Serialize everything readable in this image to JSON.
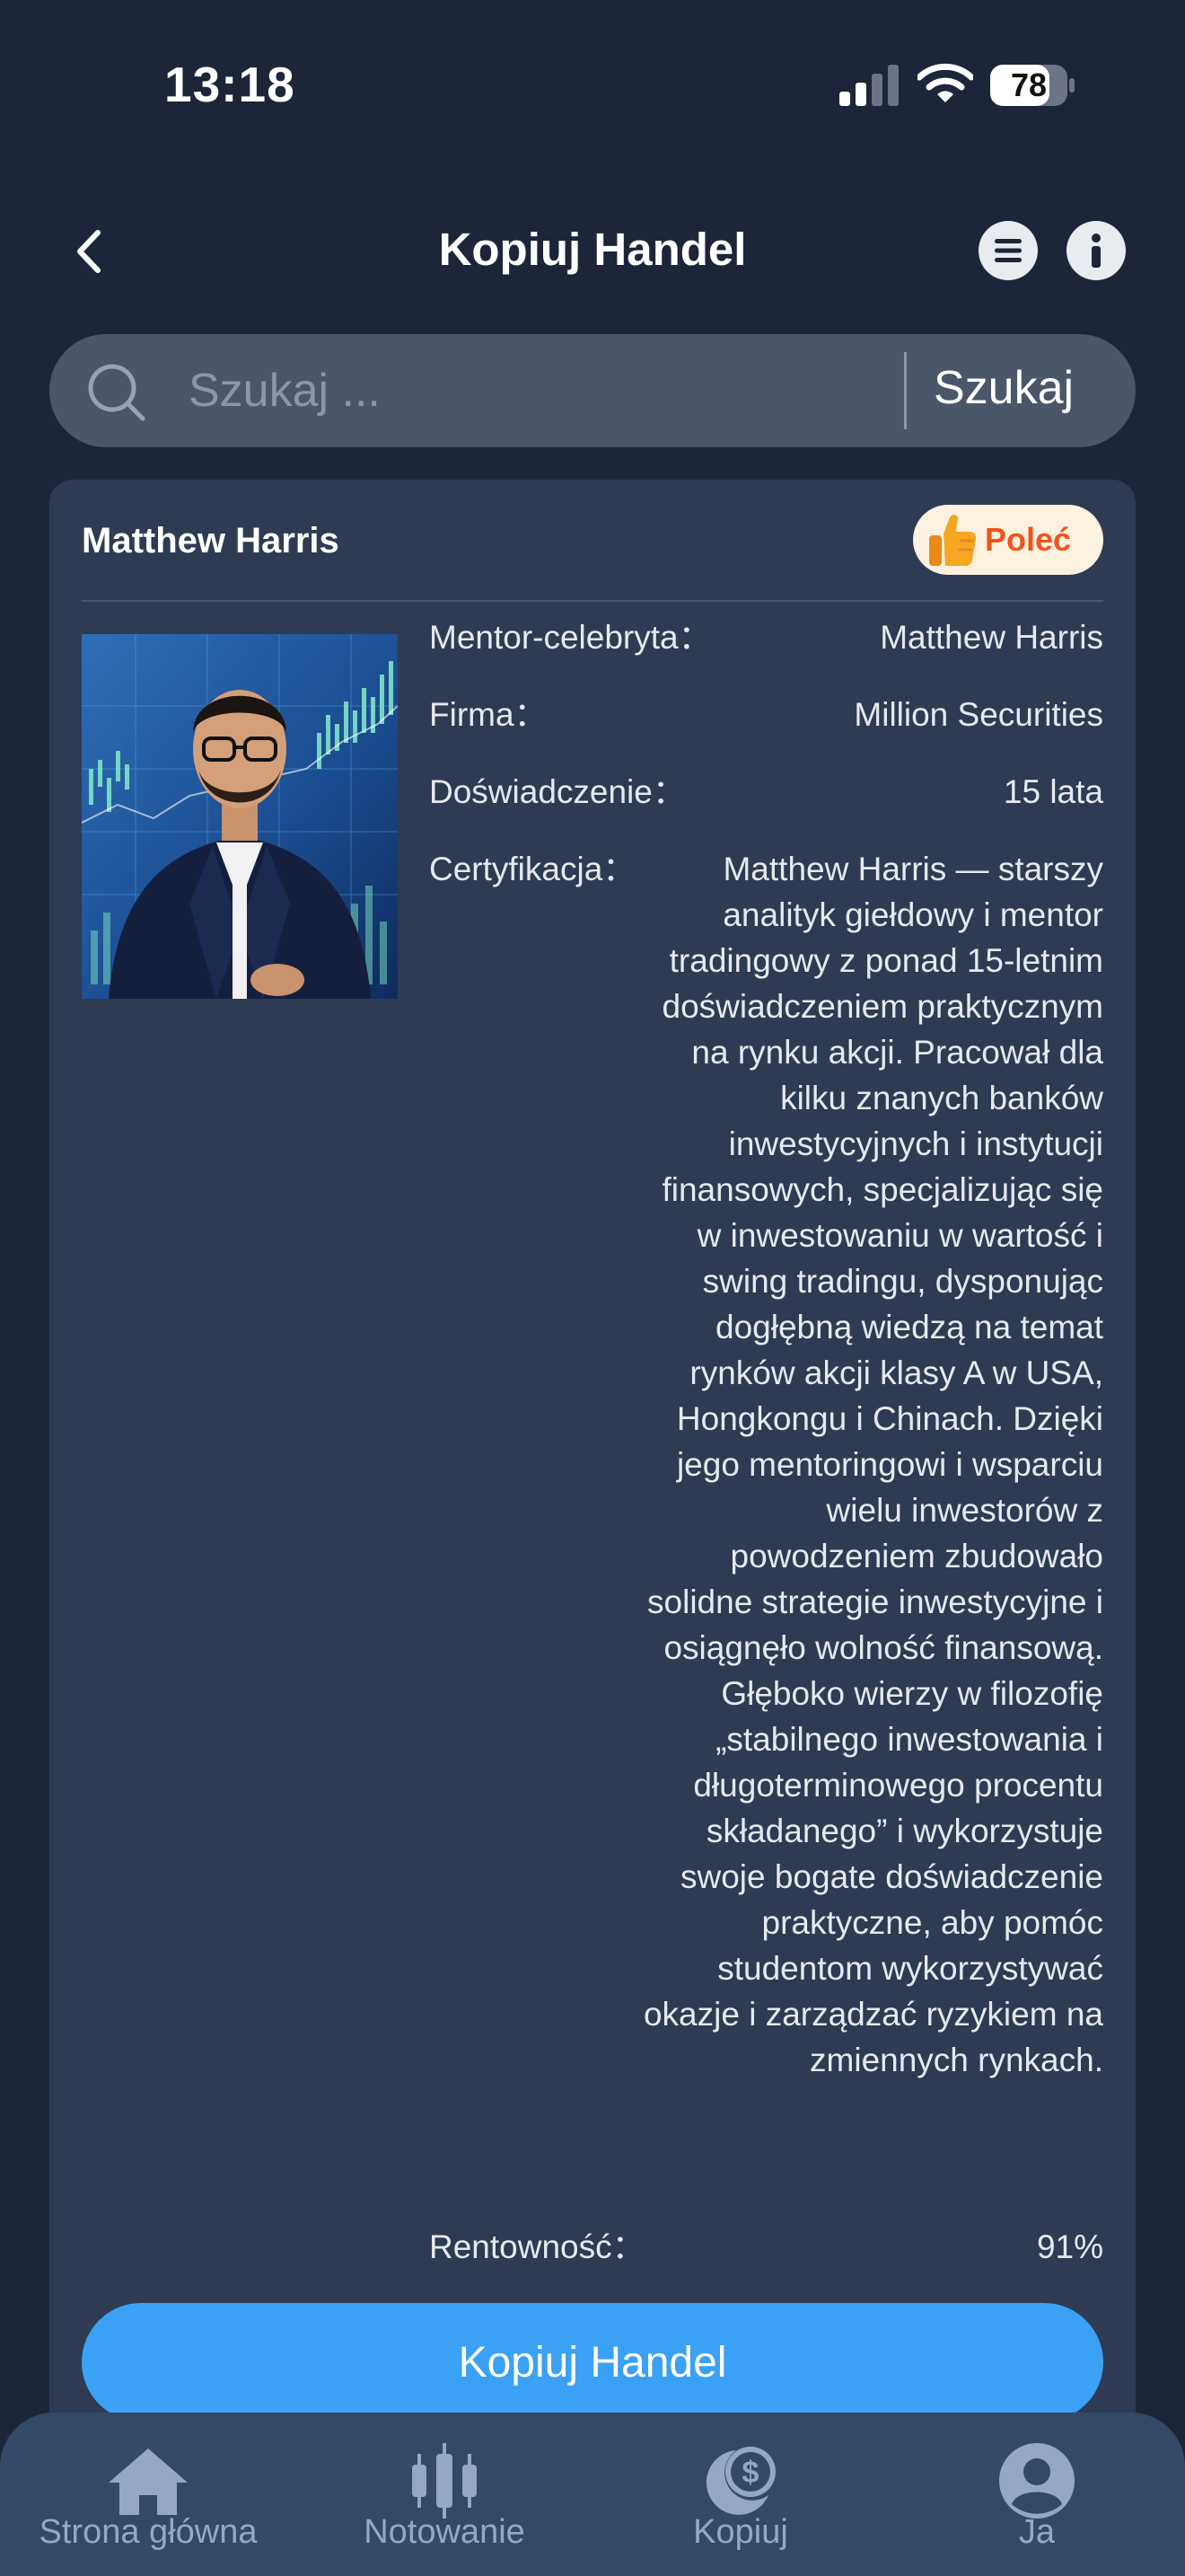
{
  "status_bar": {
    "time": "13:18",
    "battery": "78"
  },
  "header": {
    "title": "Kopiuj Handel"
  },
  "search": {
    "placeholder": "Szukaj ...",
    "button_label": "Szukaj"
  },
  "mentor": {
    "name": "Matthew Harris",
    "recommend_label": "Poleć",
    "rows": [
      {
        "label": "Mentor-celebryta：",
        "value": "Matthew Harris"
      },
      {
        "label": "Firma：",
        "value": "Million Securities"
      },
      {
        "label": "Doświadczenie：",
        "value": "15 lata"
      },
      {
        "label": "Certyfikacja：",
        "value": "Matthew Harris — starszy analityk giełdowy i mentor tradingowy z ponad 15-letnim doświadczeniem praktycznym na rynku akcji. Pracował dla kilku znanych banków inwestycyjnych i instytucji finansowych, specjalizując się w inwestowaniu w wartość i swing tradingu, dysponując dogłębną wiedzą na temat rynków akcji klasy A w USA, Hongkongu i Chinach. Dzięki jego mentoringowi i wsparciu wielu inwestorów z powodzeniem zbudowało solidne strategie inwestycyjne i osiągnęło wolność finansową. Głęboko wierzy w filozofię „stabilnego inwestowania i długoterminowego procentu składanego” i wykorzystuje swoje bogate doświadczenie praktyczne, aby pomóc studentom wykorzystywać okazje i zarządzać ryzykiem na zmiennych rynkach."
      },
      {
        "label": "Rentowność：",
        "value": "91%"
      }
    ],
    "copy_button_label": "Kopiuj Handel"
  },
  "tab_bar": {
    "items": [
      {
        "label": "Strona główna",
        "icon": "home-icon"
      },
      {
        "label": "Notowanie",
        "icon": "candlestick-icon"
      },
      {
        "label": "Kopiuj",
        "icon": "copy-dollar-icon"
      },
      {
        "label": "Ja",
        "icon": "user-icon"
      }
    ]
  },
  "colors": {
    "background": "#1d2638",
    "card": "#2e3b53",
    "accent": "#3aa1f4",
    "recommend_text": "#f0541c",
    "tab_bar": "#344867",
    "tab_label": "#95a7c4"
  }
}
